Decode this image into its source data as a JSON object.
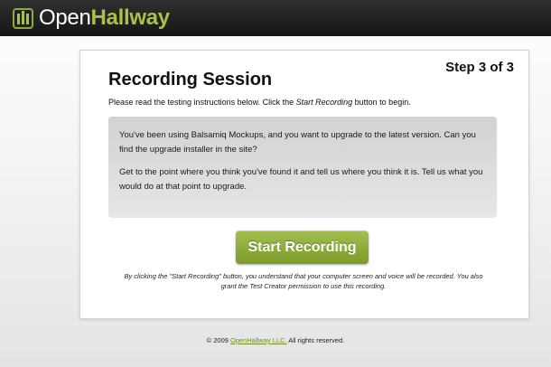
{
  "header": {
    "logo_open": "Open",
    "logo_hallway": "Hallway",
    "logo_icon": "bars-icon",
    "accent_color": "#a8c14a"
  },
  "session": {
    "step": "Step 3 of 3",
    "title": "Recording Session",
    "intro_before": "Please read the testing instructions below. Click the ",
    "intro_emphasis": "Start Recording",
    "intro_after": " button to begin.",
    "instructions": [
      "You've been using Balsamiq Mockups, and you want to upgrade to the latest version. Can you find the upgrade installer in the site?",
      "Get to the point where you think you've found it and tell us where you think it is. Tell us what you would do at that point to upgrade."
    ],
    "start_button": "Start Recording",
    "disclaimer": "By clicking the \"Start Recording\" button, you understand that your computer screen and voice will be recorded. You also grant the Test Creator permission to use this recording."
  },
  "footer": {
    "copyright_before": "© 2009 ",
    "company_link": "OpenHallway LLC.",
    "copyright_after": " All rights reserved."
  }
}
